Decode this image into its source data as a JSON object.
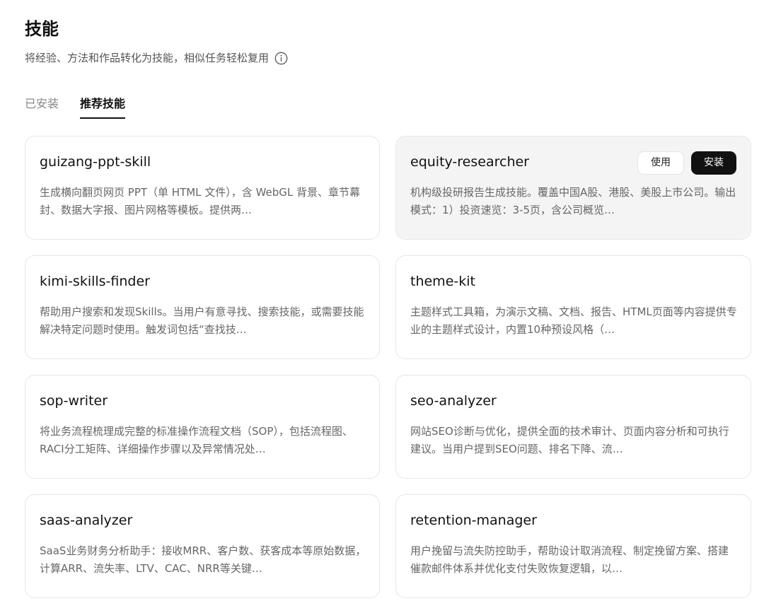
{
  "header": {
    "title": "技能",
    "subtitle": "将经验、方法和作品转化为技能，相似任务轻松复用",
    "info_icon": "info-circle-icon"
  },
  "tabs": [
    {
      "label": "已安装",
      "active": false
    },
    {
      "label": "推荐技能",
      "active": true
    }
  ],
  "actions": {
    "use_label": "使用",
    "install_label": "安装"
  },
  "skills": [
    {
      "name": "guizang-ppt-skill",
      "desc": "生成横向翻页网页 PPT（单 HTML 文件），含 WebGL 背景、章节幕封、数据大字报、图片网格等模板。提供两…"
    },
    {
      "name": "equity-researcher",
      "desc": "机构级投研报告生成技能。覆盖中国A股、港股、美股上市公司。输出模式：1）投资速览：3-5页，含公司概览…"
    },
    {
      "name": "kimi-skills-finder",
      "desc": "帮助用户搜索和发现Skills。当用户有意寻找、搜索技能，或需要技能解决特定问题时使用。触发词包括“查找技…"
    },
    {
      "name": "theme-kit",
      "desc": "主题样式工具箱，为演示文稿、文档、报告、HTML页面等内容提供专业的主题样式设计，内置10种预设风格（…"
    },
    {
      "name": "sop-writer",
      "desc": "将业务流程梳理成完整的标准操作流程文档（SOP），包括流程图、RACI分工矩阵、详细操作步骤以及异常情况处…"
    },
    {
      "name": "seo-analyzer",
      "desc": "网站SEO诊断与优化，提供全面的技术审计、页面内容分析和可执行建议。当用户提到SEO问题、排名下降、流…"
    },
    {
      "name": "saas-analyzer",
      "desc": "SaaS业务财务分析助手：接收MRR、客户数、获客成本等原始数据，计算ARR、流失率、LTV、CAC、NRR等关键…"
    },
    {
      "name": "retention-manager",
      "desc": "用户挽留与流失防控助手，帮助设计取消流程、制定挽留方案、搭建催款邮件体系并优化支付失败恢复逻辑，以…"
    }
  ]
}
